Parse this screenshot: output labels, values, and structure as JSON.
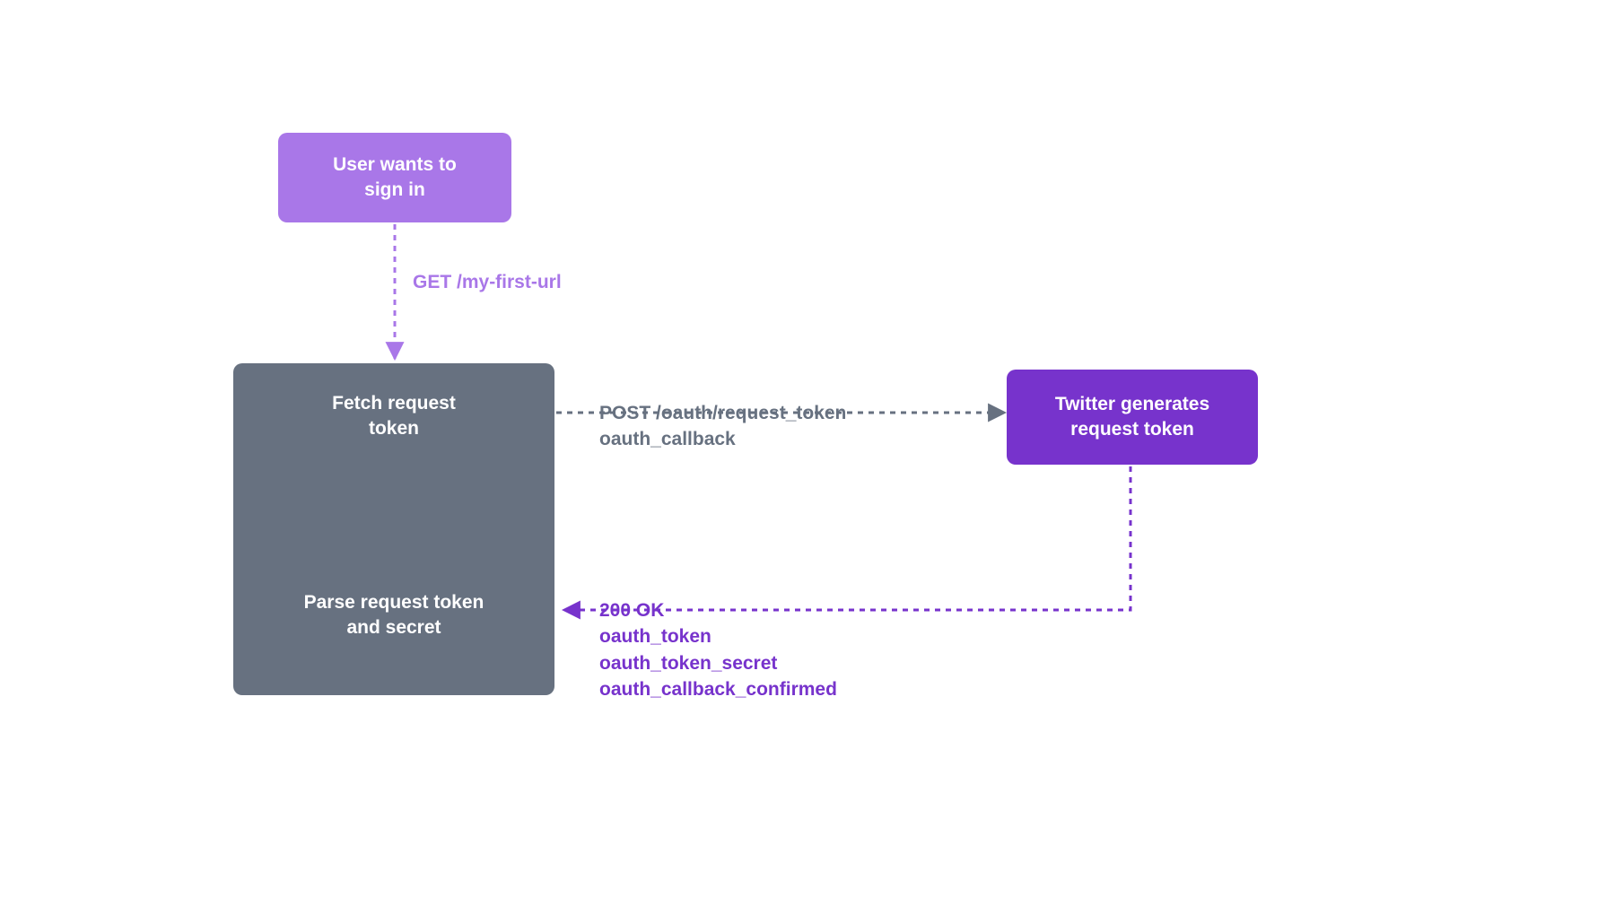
{
  "nodes": {
    "user_signin": "User wants to\nsign in",
    "fetch_token": "Fetch request\ntoken",
    "parse_token": "Parse request token\nand secret",
    "twitter_gen": "Twitter generates\nrequest token"
  },
  "edges": {
    "get_url": "GET /my-first-url",
    "post_line1": "POST /oauth/request_token",
    "post_line2": "oauth_callback",
    "resp_status": "200 OK",
    "resp_l1": "oauth_token",
    "resp_l2": "oauth_token_secret",
    "resp_l3": "oauth_callback_confirmed"
  },
  "colors": {
    "light_purple": "#a977e8",
    "gray": "#677180",
    "purple": "#7733cc"
  }
}
